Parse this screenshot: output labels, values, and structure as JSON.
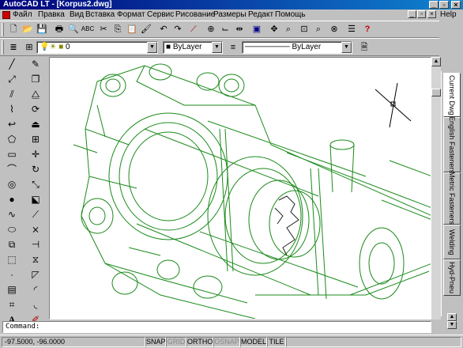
{
  "window": {
    "title": "AutoCAD LT - [Korpus2.dwg]",
    "minimize_glyph": "_",
    "restore_glyph": "▫",
    "close_glyph": "×"
  },
  "menu": {
    "items": [
      "Файл",
      "Правка",
      "Вид",
      "Вставка",
      "Формат",
      "Сервис",
      "Рисование",
      "Размеры",
      "Редакт",
      "Помощь"
    ],
    "help": "Help"
  },
  "standard_toolbar": {
    "icons": [
      "new-icon",
      "open-icon",
      "save-icon",
      "print-icon",
      "print-preview-icon",
      "spellcheck-icon",
      "cut-icon",
      "copy-icon",
      "paste-icon",
      "match-properties-icon",
      "undo-icon",
      "redo-icon",
      "snap-from-icon",
      "object-snap-icon",
      "ucs-icon",
      "distance-icon",
      "redraw-icon",
      "pan-icon",
      "zoom-realtime-icon",
      "zoom-window-icon",
      "zoom-previous-icon",
      "aerial-view-icon",
      "help-icon"
    ]
  },
  "properties_toolbar": {
    "layer_value": "0",
    "color_value": "ByLayer",
    "linetype_value": "ByLayer"
  },
  "command_line": {
    "prompt": "Command:"
  },
  "status_bar": {
    "coordinates": "-97.5000, -96.0000",
    "toggles": [
      {
        "label": "SNAP",
        "on": true
      },
      {
        "label": "GRID",
        "on": false
      },
      {
        "label": "ORTHO",
        "on": true
      },
      {
        "label": "OSNAP",
        "on": false
      },
      {
        "label": "MODEL",
        "on": true
      },
      {
        "label": "TILE",
        "on": true
      }
    ]
  },
  "design_center_tabs": [
    "Current Dwg",
    "English Fasteners",
    "Metric Fasteners",
    "Welding",
    "Hyd-Pneu"
  ],
  "colors": {
    "title_start": "#00007b",
    "title_end": "#1084d0",
    "drawing_lines": "#1a8a1a",
    "canvas": "#ffffff"
  }
}
